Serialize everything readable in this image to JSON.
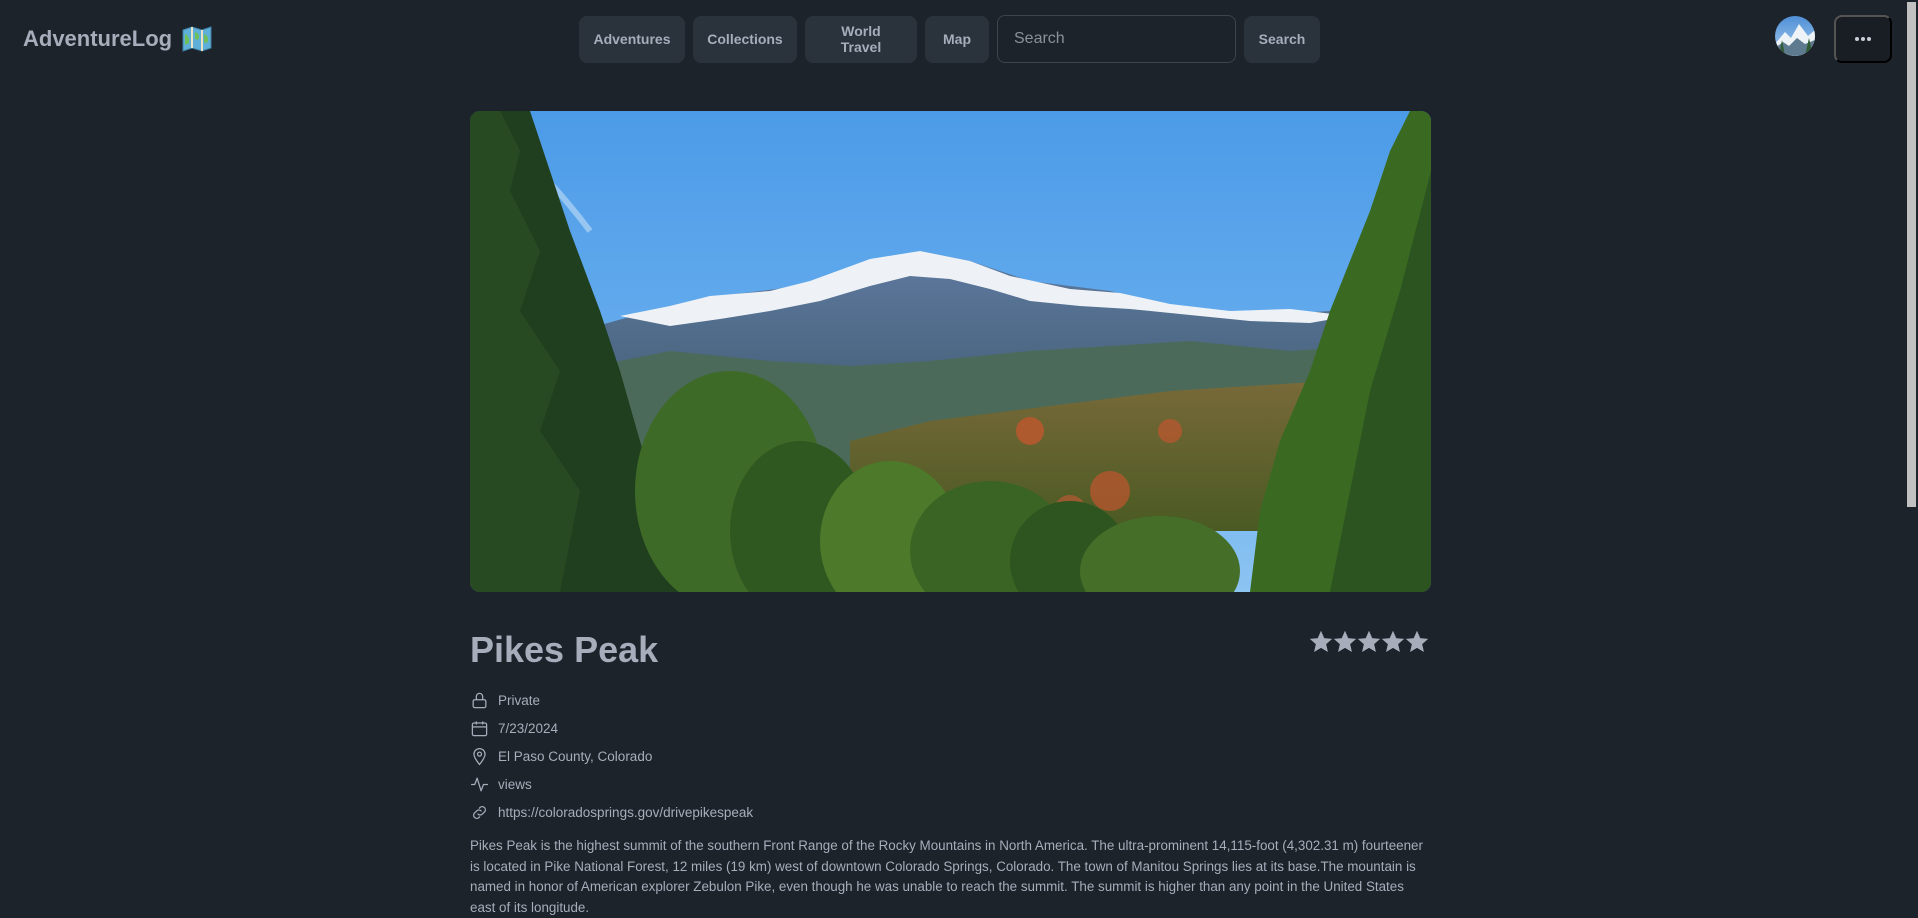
{
  "navbar": {
    "brand": "AdventureLog",
    "brand_icon": "map-icon",
    "links": [
      "Adventures",
      "Collections",
      "World Travel",
      "Map"
    ],
    "search": {
      "placeholder": "Search",
      "value": ""
    },
    "search_button": "Search",
    "more_icon": "ellipsis-icon"
  },
  "adventure": {
    "title": "Pikes Peak",
    "rating": 5,
    "rating_max": 5,
    "visibility": "Private",
    "date": "7/23/2024",
    "location": "El Paso County, Colorado",
    "activity": "views",
    "link": "https://coloradosprings.gov/drivepikespeak",
    "description": "Pikes Peak is the highest summit of the southern Front Range of the Rocky Mountains in North America. The ultra-prominent 14,115-foot (4,302.31 m) fourteener is located in Pike National Forest, 12 miles (19 km) west of downtown Colorado Springs, Colorado. The town of Manitou Springs lies at its base.The mountain is named in honor of American explorer Zebulon Pike, even though he was unable to reach the summit. The summit is higher than any point in the United States east of its longitude."
  },
  "colors": {
    "background": "#1d232a",
    "button": "#2a323c",
    "text": "#a6adbb"
  }
}
